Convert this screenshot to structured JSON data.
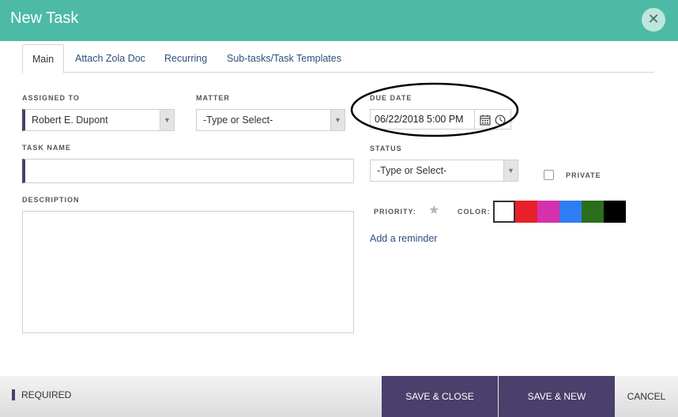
{
  "dialog": {
    "title": "New Task",
    "close_icon": "close-icon"
  },
  "tabs": [
    {
      "label": "Main",
      "active": true
    },
    {
      "label": "Attach Zola Doc",
      "active": false
    },
    {
      "label": "Recurring",
      "active": false
    },
    {
      "label": "Sub-tasks/Task Templates",
      "active": false
    }
  ],
  "form": {
    "assigned_to": {
      "label": "ASSIGNED TO",
      "value": "Robert E. Dupont"
    },
    "matter": {
      "label": "MATTER",
      "value": "-Type or Select-"
    },
    "due_date": {
      "label": "DUE DATE",
      "value": "06/22/2018 5:00 PM",
      "icons": [
        "calendar-icon",
        "clock-icon"
      ]
    },
    "task_name": {
      "label": "TASK NAME",
      "value": ""
    },
    "status": {
      "label": "STATUS",
      "value": "-Type or Select-"
    },
    "private": {
      "label": "PRIVATE",
      "checked": false
    },
    "description": {
      "label": "DESCRIPTION",
      "value": ""
    },
    "priority": {
      "label": "PRIORITY:",
      "icon": "star-icon"
    },
    "color": {
      "label": "COLOR:",
      "swatches": [
        "#ffffff",
        "#e8202a",
        "#d630ac",
        "#2f7df5",
        "#2a6e1d",
        "#000000"
      ],
      "selected": 0
    },
    "reminder_link": "Add a reminder"
  },
  "footer": {
    "required_label": "REQUIRED",
    "save_close": "SAVE & CLOSE",
    "save_new": "SAVE & NEW",
    "cancel": "CANCEL"
  },
  "colors": {
    "header_bg": "#4dbaa6",
    "primary_button": "#4b3f6b",
    "link": "#2c4f7c"
  }
}
